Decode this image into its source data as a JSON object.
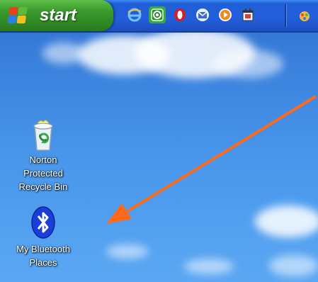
{
  "taskbar": {
    "start_label": "start",
    "quick_launch": [
      {
        "icon": "internet-explorer-icon"
      },
      {
        "icon": "media-icon"
      },
      {
        "icon": "opera-icon"
      },
      {
        "icon": "outlook-icon"
      },
      {
        "icon": "media-player-icon"
      },
      {
        "icon": "calendar-icon"
      }
    ]
  },
  "desktop": {
    "icons": [
      {
        "label_lines": [
          "Norton",
          "Protected",
          "Recycle Bin"
        ],
        "icon": "recycle-bin-icon"
      },
      {
        "label_lines": [
          "My Bluetooth",
          "Places"
        ],
        "icon": "bluetooth-icon"
      }
    ]
  },
  "colors": {
    "arrow": "#ff6a1a",
    "taskbar_blue": "#245edb",
    "start_green": "#3a9a2c",
    "bluetooth_blue": "#1a3fd6"
  }
}
